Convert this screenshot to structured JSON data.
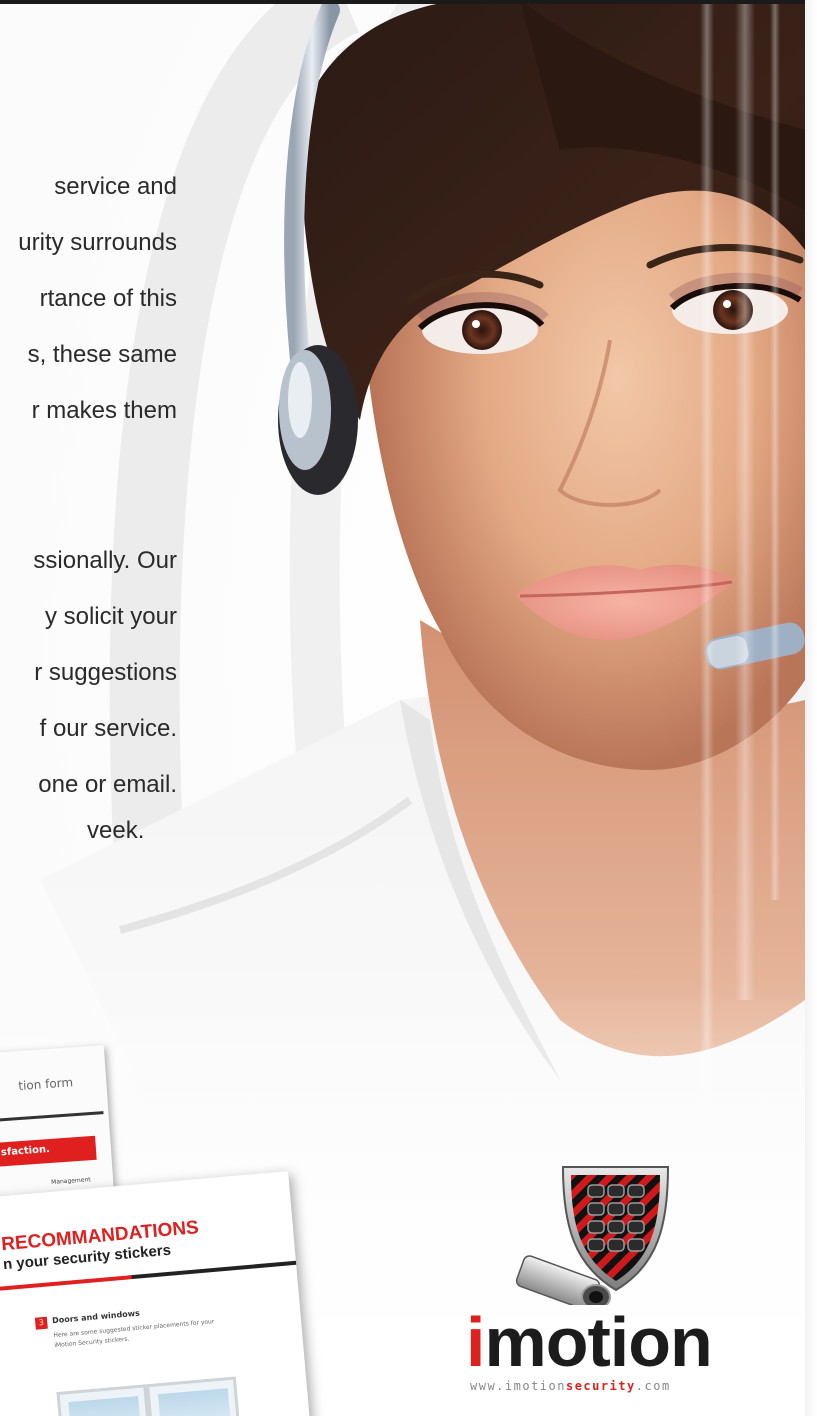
{
  "paragraph1": [
    "service  and",
    "urity surrounds",
    "rtance of this",
    "s, these same",
    "r makes them"
  ],
  "paragraph2": [
    "ssionally. Our",
    "y  solicit  your",
    "r suggestions",
    "f  our service.",
    "one or email.",
    "veek."
  ],
  "brochure_small": {
    "title": "tion form",
    "bar_text": "sfaction.",
    "small_label": "Management"
  },
  "brochure_large": {
    "title": "RECOMMANDATIONS",
    "subtitle": "n your security stickers",
    "step_number": "3",
    "step_title": "Doors and windows",
    "step_text_1": "Here are some suggested sticker placements for your",
    "step_text_2": "iMotion Security stickers."
  },
  "logo": {
    "word_first": "i",
    "word_rest": "motion",
    "url_prefix": "www.imotion",
    "url_bold": "security",
    "url_suffix": ".com"
  },
  "colors": {
    "brand_red": "#e0201f",
    "text": "#2a2a2a"
  },
  "icons": [
    "shield-keypad-icon",
    "security-camera-icon",
    "headset-icon"
  ]
}
